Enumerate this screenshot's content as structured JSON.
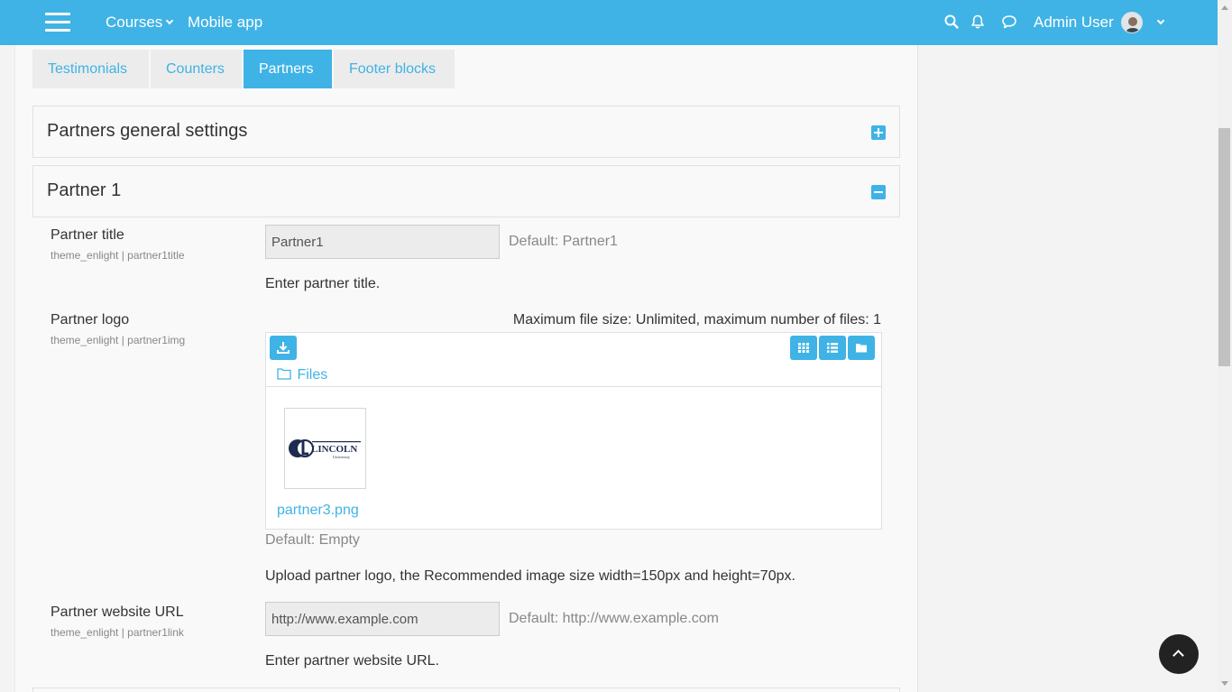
{
  "nav": {
    "courses_label": "Courses",
    "mobile_label": "Mobile app",
    "user_name": "Admin User"
  },
  "tabs": [
    {
      "label": "Testimonials",
      "active": false
    },
    {
      "label": "Counters",
      "active": false
    },
    {
      "label": "Partners",
      "active": true
    },
    {
      "label": "Footer blocks",
      "active": false
    }
  ],
  "sections": {
    "general_title": "Partners general settings",
    "partner1_title": "Partner 1"
  },
  "fields": {
    "title": {
      "label": "Partner title",
      "setting": "theme_enlight | partner1title",
      "value": "Partner1",
      "default": "Default: Partner1",
      "description": "Enter partner title."
    },
    "logo": {
      "label": "Partner logo",
      "setting": "theme_enlight | partner1img",
      "max_size": "Maximum file size: Unlimited, maximum number of files: 1",
      "files_path": "Files",
      "file_name": "partner3.png",
      "logo_text": "LINCOLN",
      "logo_subtext": "University",
      "default": "Default: Empty",
      "description": "Upload partner logo, the Recommended image size width=150px and height=70px."
    },
    "link": {
      "label": "Partner website URL",
      "setting": "theme_enlight | partner1link",
      "value": "http://www.example.com",
      "default": "Default: http://www.example.com",
      "description": "Enter partner website URL."
    }
  },
  "colors": {
    "accent": "#3fb3e5",
    "background": "#f9f9f9"
  }
}
